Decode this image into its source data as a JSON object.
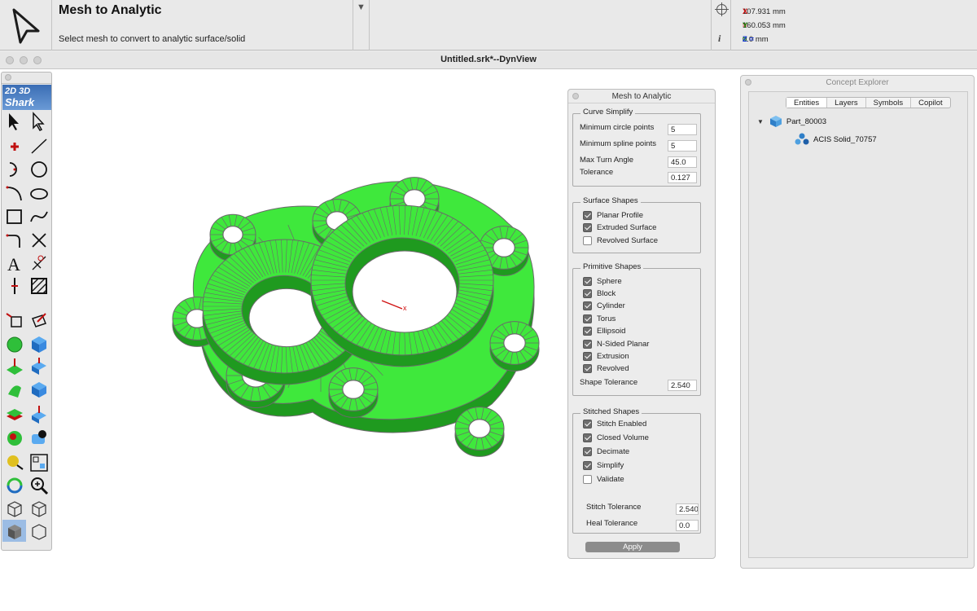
{
  "command": {
    "title": "Mesh to Analytic",
    "prompt": "Select mesh to convert to analytic surface/solid"
  },
  "coords": {
    "x_label": "X =",
    "x_value": "107.931 mm",
    "y_label": "Y =",
    "y_value": "160.053 mm",
    "z_label": "Z =",
    "z_value": "0.0 mm",
    "x_color": "#d01010",
    "y_color": "#0a8a0a",
    "z_color": "#1030d0"
  },
  "window": {
    "title": "Untitled.srk*--DynView"
  },
  "logo": {
    "line1": "2D 3D",
    "line2": "Shark"
  },
  "mesh_panel": {
    "title": "Mesh to Analytic",
    "curve_simplify": {
      "title": "Curve Simplify",
      "min_circle_label": "Minimum circle points",
      "min_circle_value": "5",
      "min_spline_label": "Minimum spline points",
      "min_spline_value": "5",
      "max_turn_label": "Max Turn Angle",
      "max_turn_value": "45.0",
      "tolerance_label": "Tolerance",
      "tolerance_value": "0.127"
    },
    "surface_shapes": {
      "title": "Surface Shapes",
      "items": [
        {
          "label": "Planar Profile",
          "checked": true
        },
        {
          "label": "Extruded Surface",
          "checked": true
        },
        {
          "label": "Revolved Surface",
          "checked": false
        }
      ]
    },
    "primitive_shapes": {
      "title": "Primitive Shapes",
      "items": [
        {
          "label": "Sphere",
          "checked": true
        },
        {
          "label": "Block",
          "checked": true
        },
        {
          "label": "Cylinder",
          "checked": true
        },
        {
          "label": "Torus",
          "checked": true
        },
        {
          "label": "Ellipsoid",
          "checked": true
        },
        {
          "label": "N-Sided Planar",
          "checked": true
        },
        {
          "label": "Extrusion",
          "checked": true
        },
        {
          "label": "Revolved",
          "checked": true
        }
      ],
      "shape_tol_label": "Shape Tolerance",
      "shape_tol_value": "2.540"
    },
    "stitched_shapes": {
      "title": "Stitched Shapes",
      "items": [
        {
          "label": "Stitch Enabled",
          "checked": true
        },
        {
          "label": "Closed Volume",
          "checked": true
        },
        {
          "label": "Decimate",
          "checked": true
        },
        {
          "label": "Simplify",
          "checked": true
        },
        {
          "label": "Validate",
          "checked": false
        }
      ],
      "stitch_tol_label": "Stitch Tolerance",
      "stitch_tol_value": "2.540",
      "heal_tol_label": "Heal Tolerance",
      "heal_tol_value": "0.0"
    },
    "apply_label": "Apply"
  },
  "concept_explorer": {
    "title": "Concept Explorer",
    "tabs": [
      "Entities",
      "Layers",
      "Symbols",
      "Copilot"
    ],
    "active_tab": "Entities",
    "tree": {
      "part": "Part_80003",
      "solid": "ACIS Solid_70757"
    }
  },
  "viewport": {
    "axis_label": "x",
    "mesh_color": "#3fe83c",
    "edge_color": "#6a6a6a"
  }
}
